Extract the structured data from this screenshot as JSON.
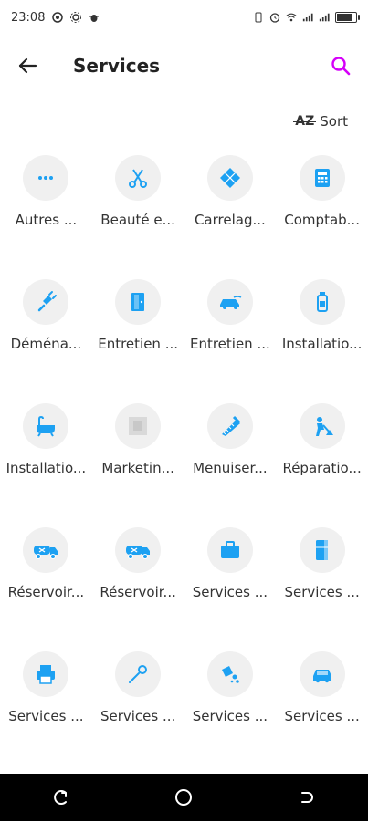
{
  "status_bar": {
    "time": "23:08"
  },
  "app_bar": {
    "title": "Services"
  },
  "sort": {
    "az": "AZ",
    "label": "Sort"
  },
  "services": [
    {
      "label": "Autres ...",
      "icon": "more-dots-icon"
    },
    {
      "label": "Beauté e...",
      "icon": "scissors-icon"
    },
    {
      "label": "Carrelag...",
      "icon": "tile-icon"
    },
    {
      "label": "Comptab...",
      "icon": "calculator-icon"
    },
    {
      "label": "Déména...",
      "icon": "plug-icon"
    },
    {
      "label": "Entretien ...",
      "icon": "door-icon"
    },
    {
      "label": "Entretien ...",
      "icon": "car-wash-icon"
    },
    {
      "label": "Installatio...",
      "icon": "bottle-icon"
    },
    {
      "label": "Installatio...",
      "icon": "bathtub-icon"
    },
    {
      "label": "Marketin...",
      "icon": "placeholder-image-icon"
    },
    {
      "label": "Menuiser...",
      "icon": "saw-icon"
    },
    {
      "label": "Réparatio...",
      "icon": "construction-worker-icon"
    },
    {
      "label": "Réservoir...",
      "icon": "tanker-truck-icon"
    },
    {
      "label": "Réservoir...",
      "icon": "tanker-truck-icon"
    },
    {
      "label": "Services ...",
      "icon": "briefcase-icon"
    },
    {
      "label": "Services ...",
      "icon": "fridge-icon"
    },
    {
      "label": "Services ...",
      "icon": "printer-icon"
    },
    {
      "label": "Services ...",
      "icon": "tool-icon"
    },
    {
      "label": "Services ...",
      "icon": "paint-splash-icon"
    },
    {
      "label": "Services ...",
      "icon": "car-icon"
    },
    {
      "label": "",
      "icon": "car-service-icon"
    },
    {
      "label": "",
      "icon": "paint-roller-icon"
    },
    {
      "label": "",
      "icon": "faucet-icon"
    },
    {
      "label": "",
      "icon": "tow-truck-icon"
    }
  ],
  "colors": {
    "accent": "#1da1f2",
    "search": "#d500f9",
    "icon_bg": "#f0f0f0",
    "nav_bar": "#000000"
  }
}
